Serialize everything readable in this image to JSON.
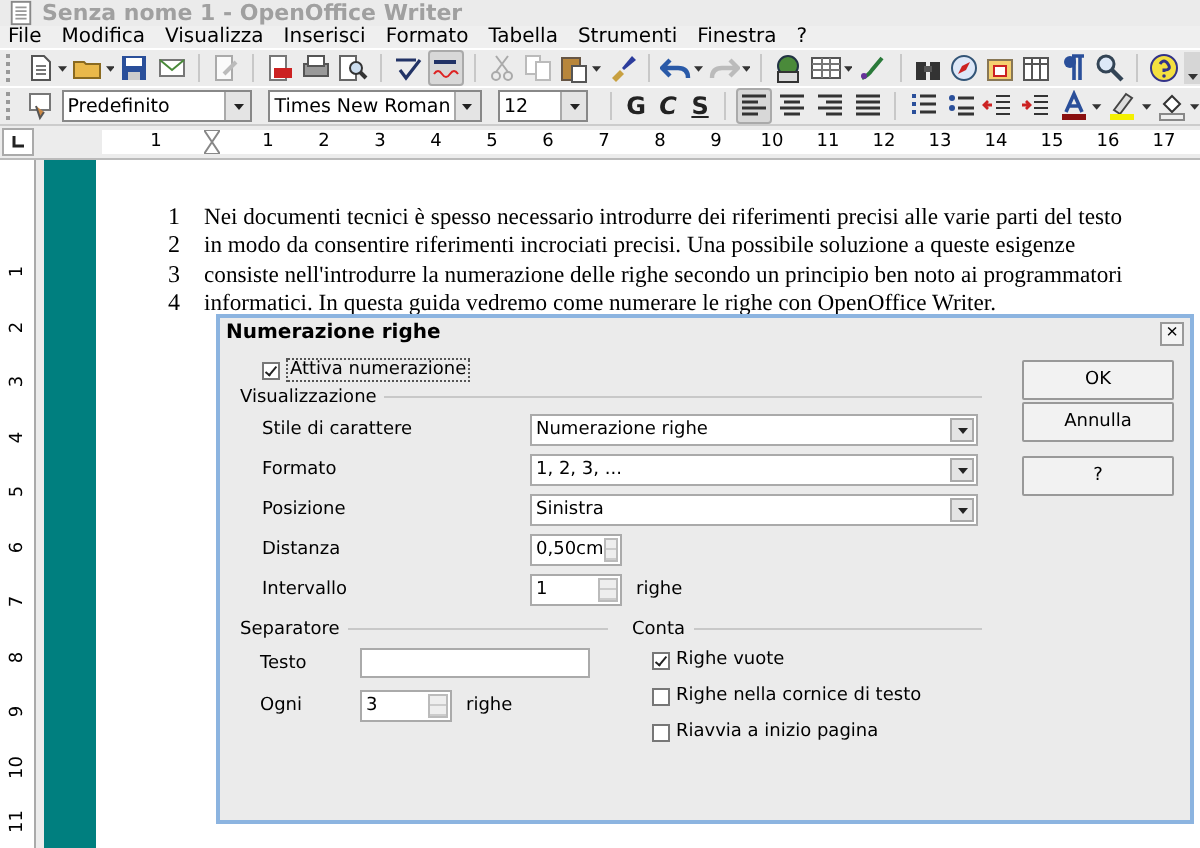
{
  "window": {
    "title": "Senza nome 1 - OpenOffice Writer"
  },
  "menu": [
    "File",
    "Modifica",
    "Visualizza",
    "Inserisci",
    "Formato",
    "Tabella",
    "Strumenti",
    "Finestra",
    "?"
  ],
  "formatting": {
    "style": "Predefinito",
    "font": "Times New Roman",
    "size": "12",
    "text_buttons": [
      {
        "label": "G",
        "kind": "bold"
      },
      {
        "label": "C",
        "kind": "italic"
      },
      {
        "label": "S",
        "kind": "underline"
      }
    ],
    "alignment": [
      {
        "selected": true
      },
      {
        "selected": false
      },
      {
        "selected": false
      },
      {
        "selected": false
      }
    ]
  },
  "ruler": {
    "before": "1",
    "ticks": [
      "1",
      "2",
      "3",
      "4",
      "5",
      "6",
      "7",
      "8",
      "9",
      "10",
      "11",
      "12",
      "13",
      "14",
      "15",
      "16",
      "17"
    ]
  },
  "vertical_ruler": [
    "1",
    "2",
    "3",
    "4",
    "5",
    "6",
    "7",
    "8",
    "9",
    "10",
    "11"
  ],
  "document": {
    "lines": [
      {
        "number": "1",
        "text": "Nei documenti tecnici è spesso necessario introdurre dei riferimenti precisi alle varie parti del testo"
      },
      {
        "number": "2",
        "text": "in modo da consentire riferimenti incrociati precisi. Una possibile soluzione a queste esigenze"
      },
      {
        "number": "3",
        "text": "consiste nell'introdurre la numerazione delle righe secondo un principio ben noto ai programmatori"
      },
      {
        "number": "4",
        "text": "informatici. In questa guida vedremo come numerare le righe con OpenOffice Writer."
      }
    ]
  },
  "dialog": {
    "title": "Numerazione righe",
    "close": "×",
    "enable": {
      "label": "Attiva numerazione",
      "checked": true
    },
    "view": {
      "title": "Visualizzazione",
      "fields": [
        {
          "label": "Stile di carattere",
          "kind": "dropdown",
          "value": "Numerazione righe"
        },
        {
          "label": "Formato",
          "kind": "dropdown",
          "value": "1, 2, 3, ..."
        },
        {
          "label": "Posizione",
          "kind": "dropdown",
          "value": "Sinistra"
        },
        {
          "label": "Distanza",
          "kind": "spin",
          "value": "0,50cm"
        },
        {
          "label": "Intervallo",
          "kind": "spin",
          "value": "1",
          "unit": "righe"
        }
      ]
    },
    "separator": {
      "title": "Separatore",
      "text_label": "Testo",
      "every_label": "Ogni",
      "every_value": "3",
      "every_unit": "righe"
    },
    "count": {
      "title": "Conta",
      "options": [
        {
          "label": "Righe vuote",
          "checked": true
        },
        {
          "label": "Righe nella cornice di testo",
          "checked": false
        },
        {
          "label": "Riavvia a inizio pagina",
          "checked": false
        }
      ]
    },
    "buttons": [
      "OK",
      "Annulla",
      "?"
    ]
  }
}
